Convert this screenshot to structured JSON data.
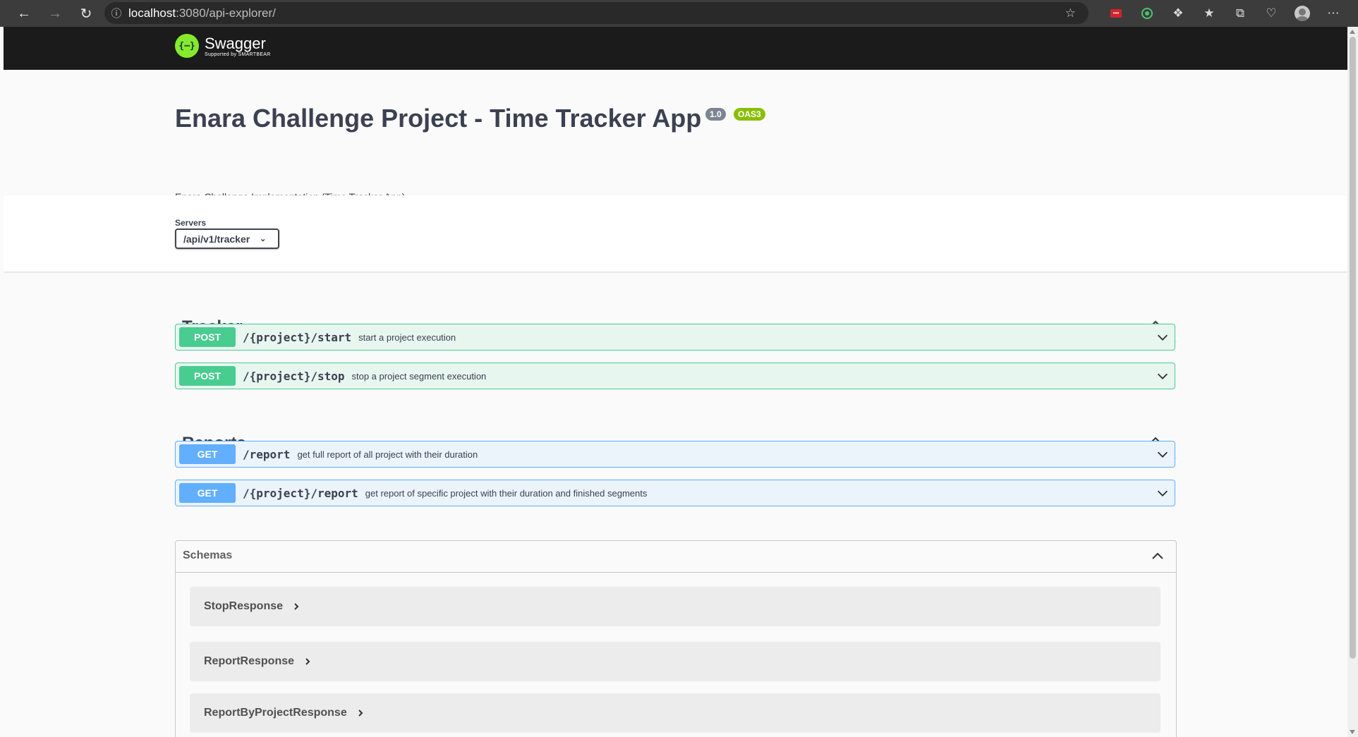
{
  "browser": {
    "url_host": "localhost",
    "url_rest": ":3080/api-explorer/"
  },
  "swagger": {
    "logo_name": "Swagger",
    "logo_sub": "Supported by SMARTBEAR"
  },
  "info": {
    "title": "Enara Challenge Project - Time Tracker App",
    "version": "1.0",
    "oas": "OAS3",
    "description": "Enara Challenge Implementation (Time Tracker App)"
  },
  "servers": {
    "label": "Servers",
    "selected": "/api/v1/tracker"
  },
  "tags": [
    {
      "name": "Tracker",
      "operations": [
        {
          "method": "POST",
          "path": "/{project}/start",
          "summary": "start a project execution"
        },
        {
          "method": "POST",
          "path": "/{project}/stop",
          "summary": "stop a project segment execution"
        }
      ]
    },
    {
      "name": "Reports",
      "operations": [
        {
          "method": "GET",
          "path": "/report",
          "summary": "get full report of all project with their duration"
        },
        {
          "method": "GET",
          "path": "/{project}/report",
          "summary": "get report of specific project with their duration and finished segments"
        }
      ]
    }
  ],
  "schemas": {
    "title": "Schemas",
    "models": [
      "StopResponse",
      "ReportResponse",
      "ReportByProjectResponse"
    ]
  },
  "colors": {
    "post": "#49cc90",
    "get": "#61affe",
    "header_bg": "#1b1b1b",
    "title": "#3b4151"
  }
}
